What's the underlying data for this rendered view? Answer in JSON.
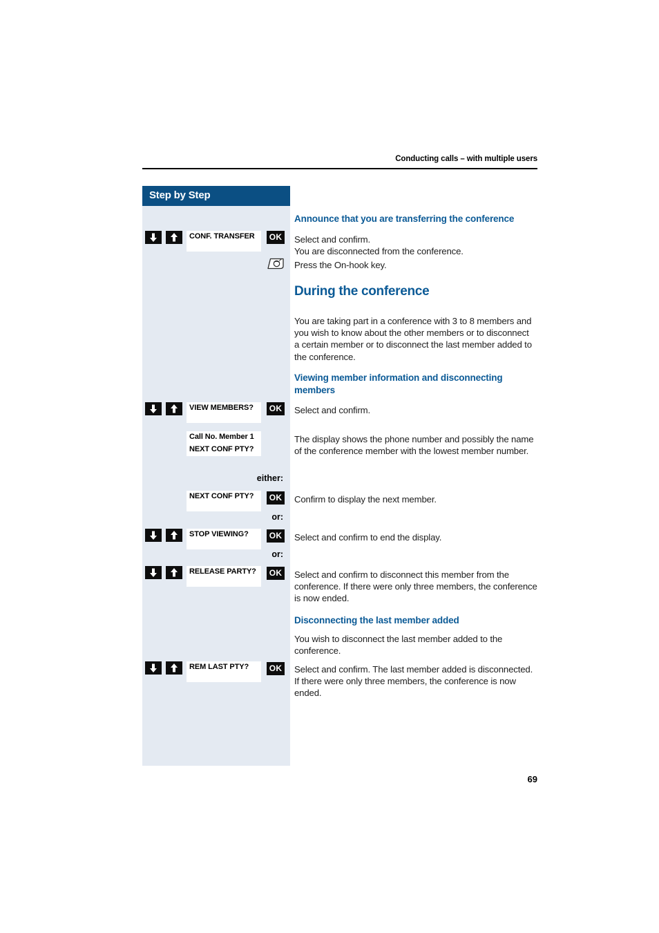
{
  "page": {
    "running_head": "Conducting calls – with multiple users",
    "page_number": "69",
    "accent_color": "#0b5a96",
    "header_bar_color": "#0b4f83",
    "sidebar_color": "#e4eaf2"
  },
  "sidebar": {
    "title": "Step by Step"
  },
  "sections": {
    "announce": {
      "heading": "Announce that you are transferring the conference",
      "line1": "Select and confirm.",
      "line2": "You are disconnected from the conference.",
      "onhook_text": "Press the On-hook key."
    },
    "during": {
      "heading": "During the conference",
      "body": "You are taking part in a conference with 3 to 8 members and you wish to know about the other members or to disconnect a certain member or to disconnect the last member added to the conference."
    },
    "viewing": {
      "heading": "Viewing member information and disconnecting members",
      "select_confirm": "Select and confirm.",
      "display_desc": "The display shows the phone number and possibly the name of the conference member with the lowest member number.",
      "confirm_next": "Confirm to display the next member.",
      "stop_viewing_desc": "Select and confirm to end the display.",
      "release_party_desc": "Select and confirm to disconnect this member from the conference. If there were only three members, the conference is now ended."
    },
    "disconnect_last": {
      "heading": "Disconnecting the last member added",
      "body": "You wish to disconnect the last member added to the conference.",
      "rem_last_desc": "Select and confirm. The last member added is disconnected. If there were only three members, the conference is now ended."
    }
  },
  "keys": {
    "ok_label": "OK",
    "down_arrow_name": "down-arrow-key",
    "up_arrow_name": "up-arrow-key",
    "onhook_name": "on-hook-key"
  },
  "display_labels": {
    "conf_transfer": "CONF. TRANSFER",
    "view_members": "VIEW MEMBERS?",
    "call_no_member": "Call No. Member  1",
    "next_conf_pty_display": "NEXT CONF PTY?",
    "next_conf_pty": "NEXT CONF PTY?",
    "stop_viewing": "STOP VIEWING?",
    "release_party": "RELEASE PARTY?",
    "rem_last_pty": "REM LAST PTY?"
  },
  "connectors": {
    "either": "either:",
    "or_1": "or:",
    "or_2": "or:"
  }
}
